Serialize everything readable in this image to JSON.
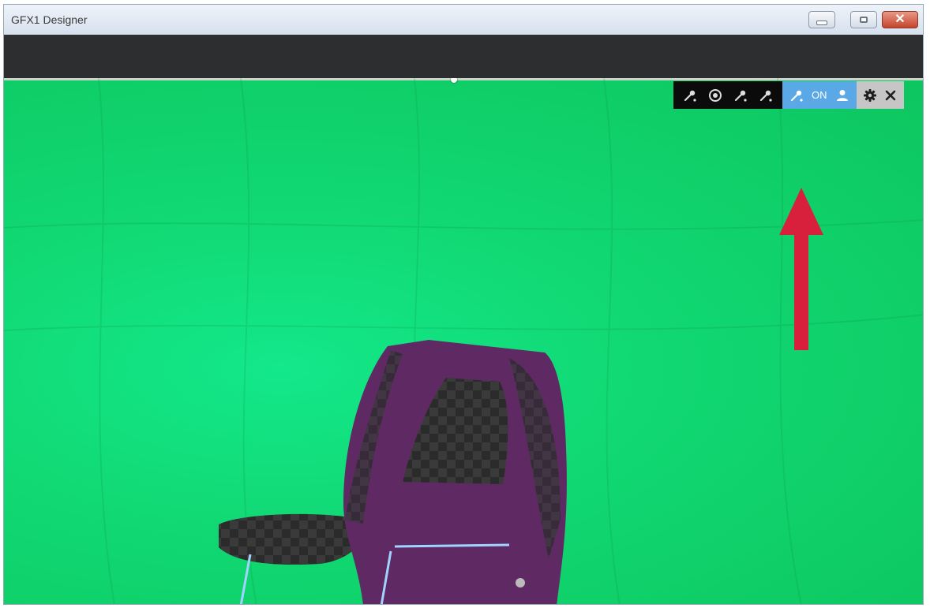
{
  "window": {
    "title": "GFX1 Designer",
    "controls": {
      "minimize": "minimize-icon",
      "maximize": "maximize-icon",
      "close": "close-icon"
    }
  },
  "toolbar": {
    "buttons": [
      {
        "name": "eyedropper-1",
        "icon": "eyedropper-icon"
      },
      {
        "name": "target",
        "icon": "target-icon"
      },
      {
        "name": "eyedropper-2",
        "icon": "eyedropper-icon"
      },
      {
        "name": "eyedropper-3",
        "icon": "eyedropper-icon"
      },
      {
        "name": "chroma-key",
        "icon": "eyedropper-icon"
      },
      {
        "name": "person",
        "icon": "person-icon"
      },
      {
        "name": "settings",
        "icon": "gear-icon"
      },
      {
        "name": "close",
        "icon": "close-icon"
      }
    ],
    "chroma_key_state": "ON",
    "highlight_color": "#5aa8e6"
  },
  "scene": {
    "background_color": "#11d873",
    "subject_color": "#5f2a63",
    "annotation_color": "#d81f3c"
  }
}
